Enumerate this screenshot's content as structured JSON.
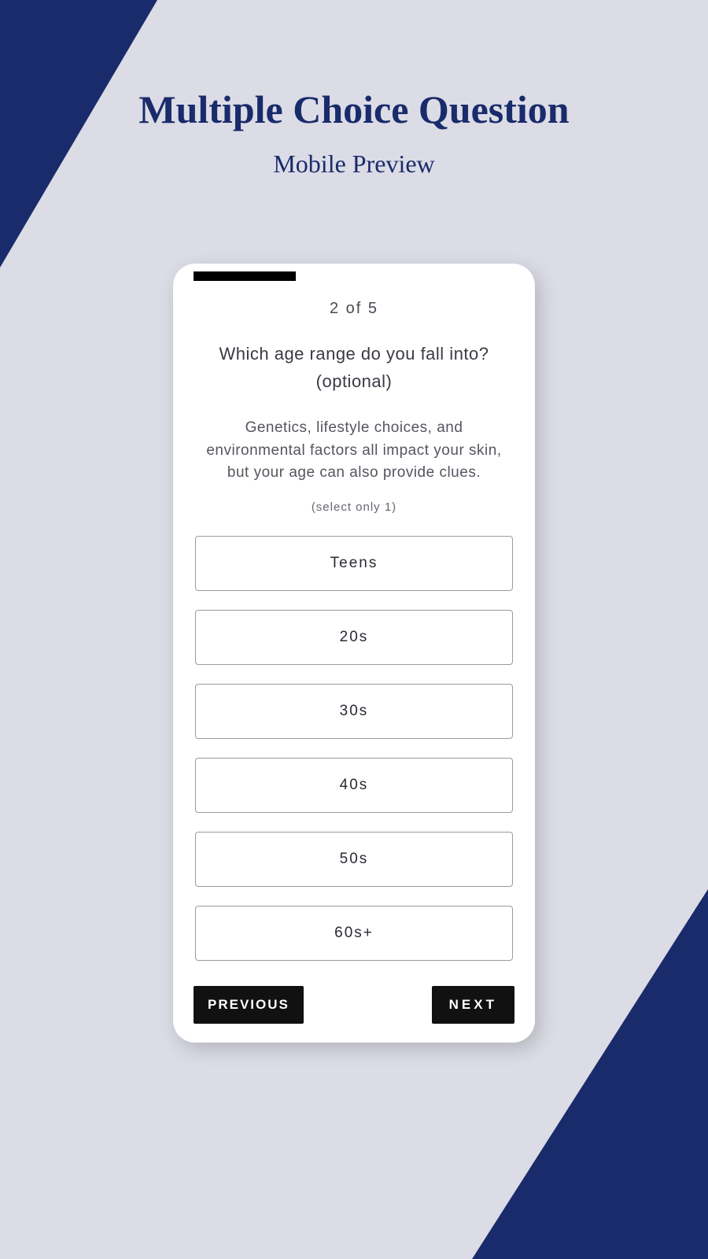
{
  "page": {
    "title": "Multiple Choice Question",
    "subtitle": "Mobile Preview"
  },
  "quiz": {
    "step_label": "2  of  5",
    "question": "Which age range do you fall into? (optional)",
    "description": "Genetics, lifestyle choices, and environmental factors all impact your skin, but your age can also provide clues.",
    "select_hint": "(select only 1)",
    "options": [
      {
        "label": "Teens"
      },
      {
        "label": "20s"
      },
      {
        "label": "30s"
      },
      {
        "label": "40s"
      },
      {
        "label": "50s"
      },
      {
        "label": "60s+"
      }
    ],
    "nav": {
      "previous": "PREVIOUS",
      "next": "NEXT"
    }
  }
}
